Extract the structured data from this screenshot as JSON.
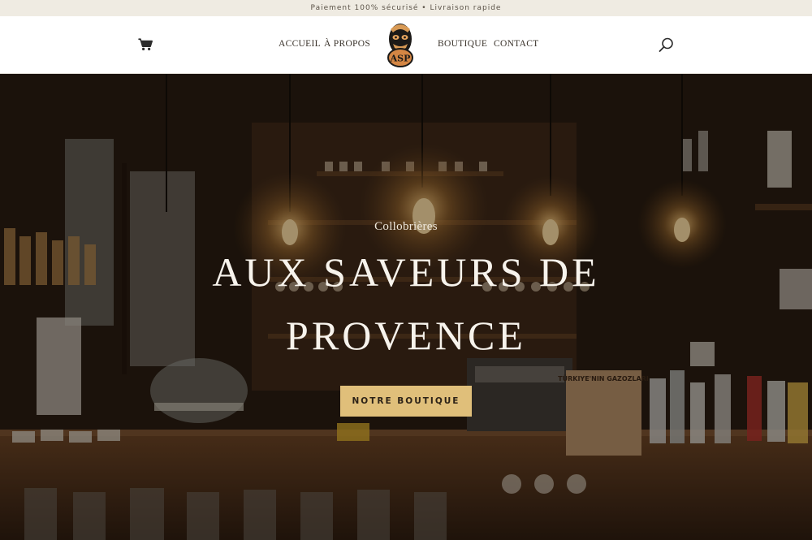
{
  "topbar": {
    "text": "Paiement 100% sécurisé • Livraison rapide"
  },
  "header": {
    "nav": {
      "accueil": "ACCUEIL",
      "apropos": "À PROPOS",
      "boutique": "BOUTIQUE",
      "contact": "CONTACT"
    },
    "logo_letters": "ASP",
    "icons": {
      "cart": "cart-icon",
      "search": "search-icon"
    }
  },
  "hero": {
    "subtitle": "Collobrières",
    "title": "AUX SAVEURS DE PROVENCE",
    "button_label": "NOTRE BOUTIQUE",
    "sign_text": "TÜRKIYE'NIN GAZOZLARI"
  },
  "colors": {
    "accent": "#e0bf7a",
    "topbar_bg": "#efebe2",
    "header_bg": "#ffffff",
    "hero_text": "#f7f3ec"
  }
}
